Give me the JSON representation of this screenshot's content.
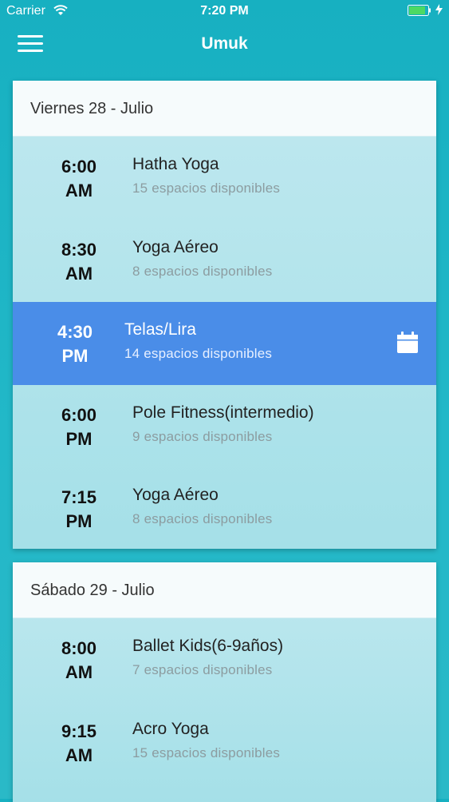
{
  "status_bar": {
    "carrier": "Carrier",
    "time": "7:20 PM"
  },
  "nav": {
    "title": "Umuk"
  },
  "days": [
    {
      "header": "Viernes 28 - Julio",
      "classes": [
        {
          "hour": "6:00",
          "ampm": "AM",
          "name": "Hatha Yoga",
          "spaces": "15 espacios disponibles"
        },
        {
          "hour": "8:30",
          "ampm": "AM",
          "name": "Yoga Aéreo",
          "spaces": "8 espacios disponibles"
        },
        {
          "hour": "4:30",
          "ampm": "PM",
          "name": "Telas/Lira",
          "spaces": "14 espacios disponibles",
          "selected": true
        },
        {
          "hour": "6:00",
          "ampm": "PM",
          "name": "Pole Fitness(intermedio)",
          "spaces": "9 espacios disponibles"
        },
        {
          "hour": "7:15",
          "ampm": "PM",
          "name": "Yoga Aéreo",
          "spaces": "8 espacios disponibles"
        }
      ]
    },
    {
      "header": "Sábado 29 - Julio",
      "classes": [
        {
          "hour": "8:00",
          "ampm": "AM",
          "name": "Ballet Kids(6-9años)",
          "spaces": "7 espacios disponibles"
        },
        {
          "hour": "9:15",
          "ampm": "AM",
          "name": "Acro Yoga",
          "spaces": "15 espacios disponibles"
        }
      ]
    }
  ],
  "colors": {
    "accent": "#4a8de8",
    "background": "#1fb4c5"
  },
  "icons": {
    "selected_slot": "calendar-icon"
  }
}
